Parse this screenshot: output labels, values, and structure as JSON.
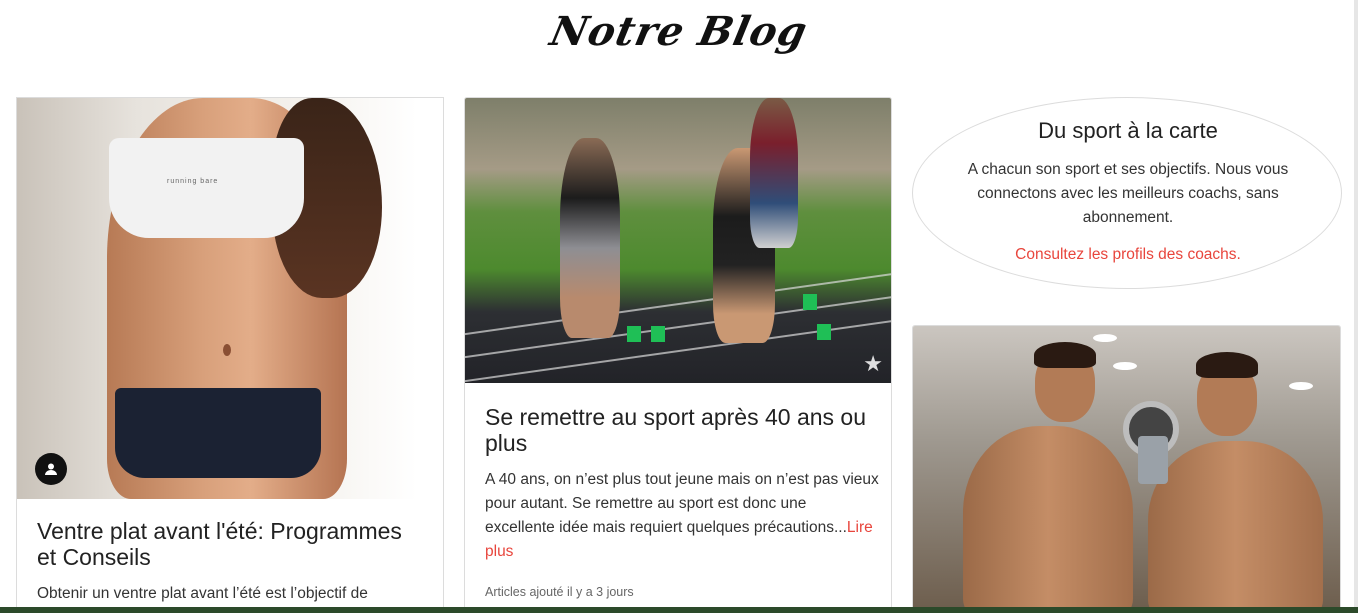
{
  "header": {
    "title": "Notre Blog"
  },
  "cards": [
    {
      "title": "Ventre plat avant l'été: Programmes et Conseils",
      "excerpt": "Obtenir un ventre plat avant l’été est l’objectif de",
      "top_text": "running bare",
      "author_icon": "user-icon"
    },
    {
      "title": "Se remettre au sport après 40 ans ou plus",
      "excerpt": "A 40 ans, on n’est plus tout jeune mais on n’est pas vieux pour autant. Se remettre au sport est donc une excellente idée mais requiert quelques précautions...",
      "read_more": "Lire plus",
      "meta": "Articles ajouté il y a 3 jours"
    }
  ],
  "promo": {
    "title": "Du sport à la carte",
    "text": "A chacun son sport et ses objectifs. Nous vous connectons avec les meilleurs coachs, sans abonnement.",
    "link": "Consultez les profils des coachs."
  },
  "colors": {
    "accent": "#e8453c",
    "border": "#dcdcdc"
  }
}
